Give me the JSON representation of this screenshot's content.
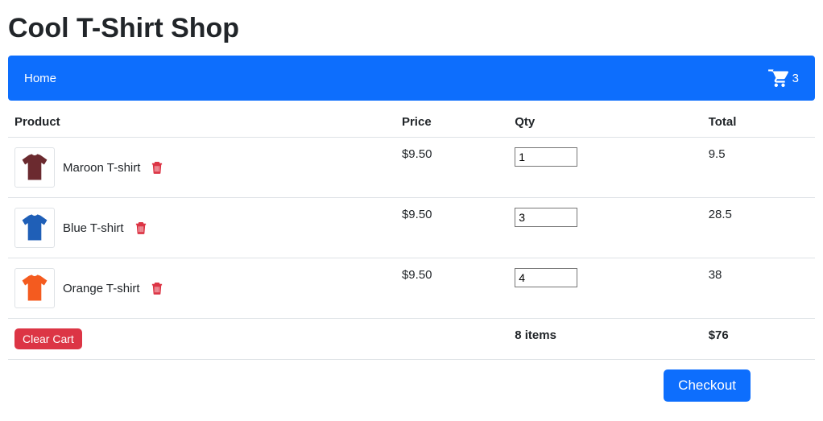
{
  "page": {
    "title": "Cool T-Shirt Shop"
  },
  "nav": {
    "home": "Home",
    "cartCount": "3"
  },
  "tableHeaders": {
    "product": "Product",
    "price": "Price",
    "qty": "Qty",
    "total": "Total"
  },
  "items": [
    {
      "name": "Maroon T-shirt",
      "price": "$9.50",
      "qty": "1",
      "total": "9.5",
      "color": "#6b2a2f"
    },
    {
      "name": "Blue T-shirt",
      "price": "$9.50",
      "qty": "3",
      "total": "28.5",
      "color": "#1f5fb7"
    },
    {
      "name": "Orange T-shirt",
      "price": "$9.50",
      "qty": "4",
      "total": "38",
      "color": "#f45b1f"
    }
  ],
  "summary": {
    "itemsLabel": "8 items",
    "grandTotal": "$76"
  },
  "buttons": {
    "clear": "Clear Cart",
    "checkout": "Checkout"
  },
  "icons": {
    "cart": "cart-icon",
    "trash": "trash-icon"
  }
}
